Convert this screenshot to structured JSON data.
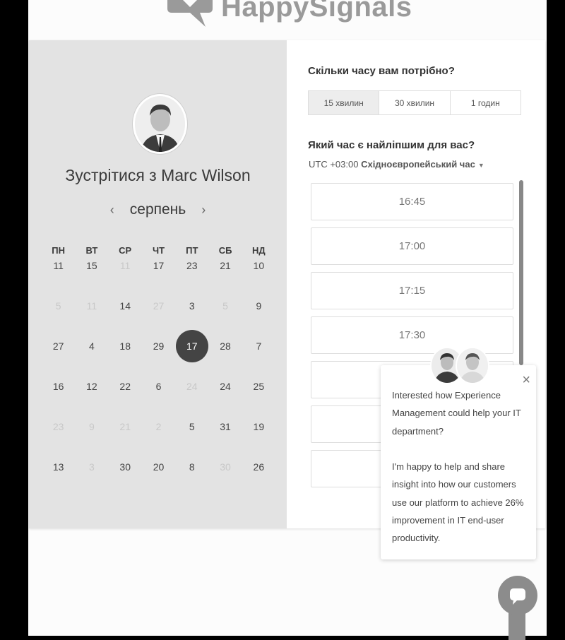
{
  "brand": {
    "name": "HappySignals"
  },
  "booking": {
    "title_prefix": "Зустрітися з",
    "host_name": "Marc Wilson",
    "month": "серпень",
    "prev_icon": "‹",
    "next_icon": "›",
    "weekdays": [
      "ПН",
      "ВТ",
      "СР",
      "ЧТ",
      "ПТ",
      "СБ",
      "НД"
    ],
    "calendar": [
      [
        {
          "d": "11"
        },
        {
          "d": "15"
        },
        {
          "d": "11",
          "muted": true
        },
        {
          "d": "17"
        },
        {
          "d": "23"
        },
        {
          "d": "21"
        },
        {
          "d": "10"
        }
      ],
      [
        {
          "d": "5",
          "muted": true
        },
        {
          "d": "11",
          "muted": true
        },
        {
          "d": "14"
        },
        {
          "d": "27",
          "muted": true
        },
        {
          "d": "3"
        },
        {
          "d": "5",
          "muted": true
        },
        {
          "d": "9"
        }
      ],
      [
        {
          "d": "27"
        },
        {
          "d": "4"
        },
        {
          "d": "18"
        },
        {
          "d": "29"
        },
        {
          "d": "17",
          "selected": true
        },
        {
          "d": "28"
        },
        {
          "d": "7"
        }
      ],
      [
        {
          "d": "16"
        },
        {
          "d": "12"
        },
        {
          "d": "22"
        },
        {
          "d": "6"
        },
        {
          "d": "24",
          "muted": true
        },
        {
          "d": "24"
        },
        {
          "d": "25"
        }
      ],
      [
        {
          "d": "23",
          "muted": true
        },
        {
          "d": "9",
          "muted": true
        },
        {
          "d": "21",
          "muted": true
        },
        {
          "d": "2",
          "muted": true
        },
        {
          "d": "5"
        },
        {
          "d": "31"
        },
        {
          "d": "19"
        }
      ],
      [
        {
          "d": "13"
        },
        {
          "d": "3",
          "muted": true
        },
        {
          "d": "30"
        },
        {
          "d": "20"
        },
        {
          "d": "8"
        },
        {
          "d": "30",
          "muted": true
        },
        {
          "d": "26"
        }
      ]
    ]
  },
  "duration": {
    "question": "Скільки часу вам потрібно?",
    "options": [
      {
        "label": "15 хвилин",
        "active": true
      },
      {
        "label": "30 хвилин"
      },
      {
        "label": "1 годин"
      }
    ]
  },
  "time": {
    "question": "Який час є найліпшим для вас?",
    "tz_offset": "UTC +03:00",
    "tz_name": "Східноєвропейський час",
    "slots": [
      "16:45",
      "17:00",
      "17:15",
      "17:30",
      "",
      "",
      "",
      ""
    ]
  },
  "chat": {
    "close_icon": "×",
    "message": "Interested how Experience Management could help your IT department?\n\nI'm happy to help and share insight into how our customers use our platform to achieve 26% improvement in IT end-user productivity."
  },
  "icons": {
    "chat": "chat-bubble-icon",
    "close": "close-icon",
    "logo": "speech-heart-logo-icon"
  }
}
